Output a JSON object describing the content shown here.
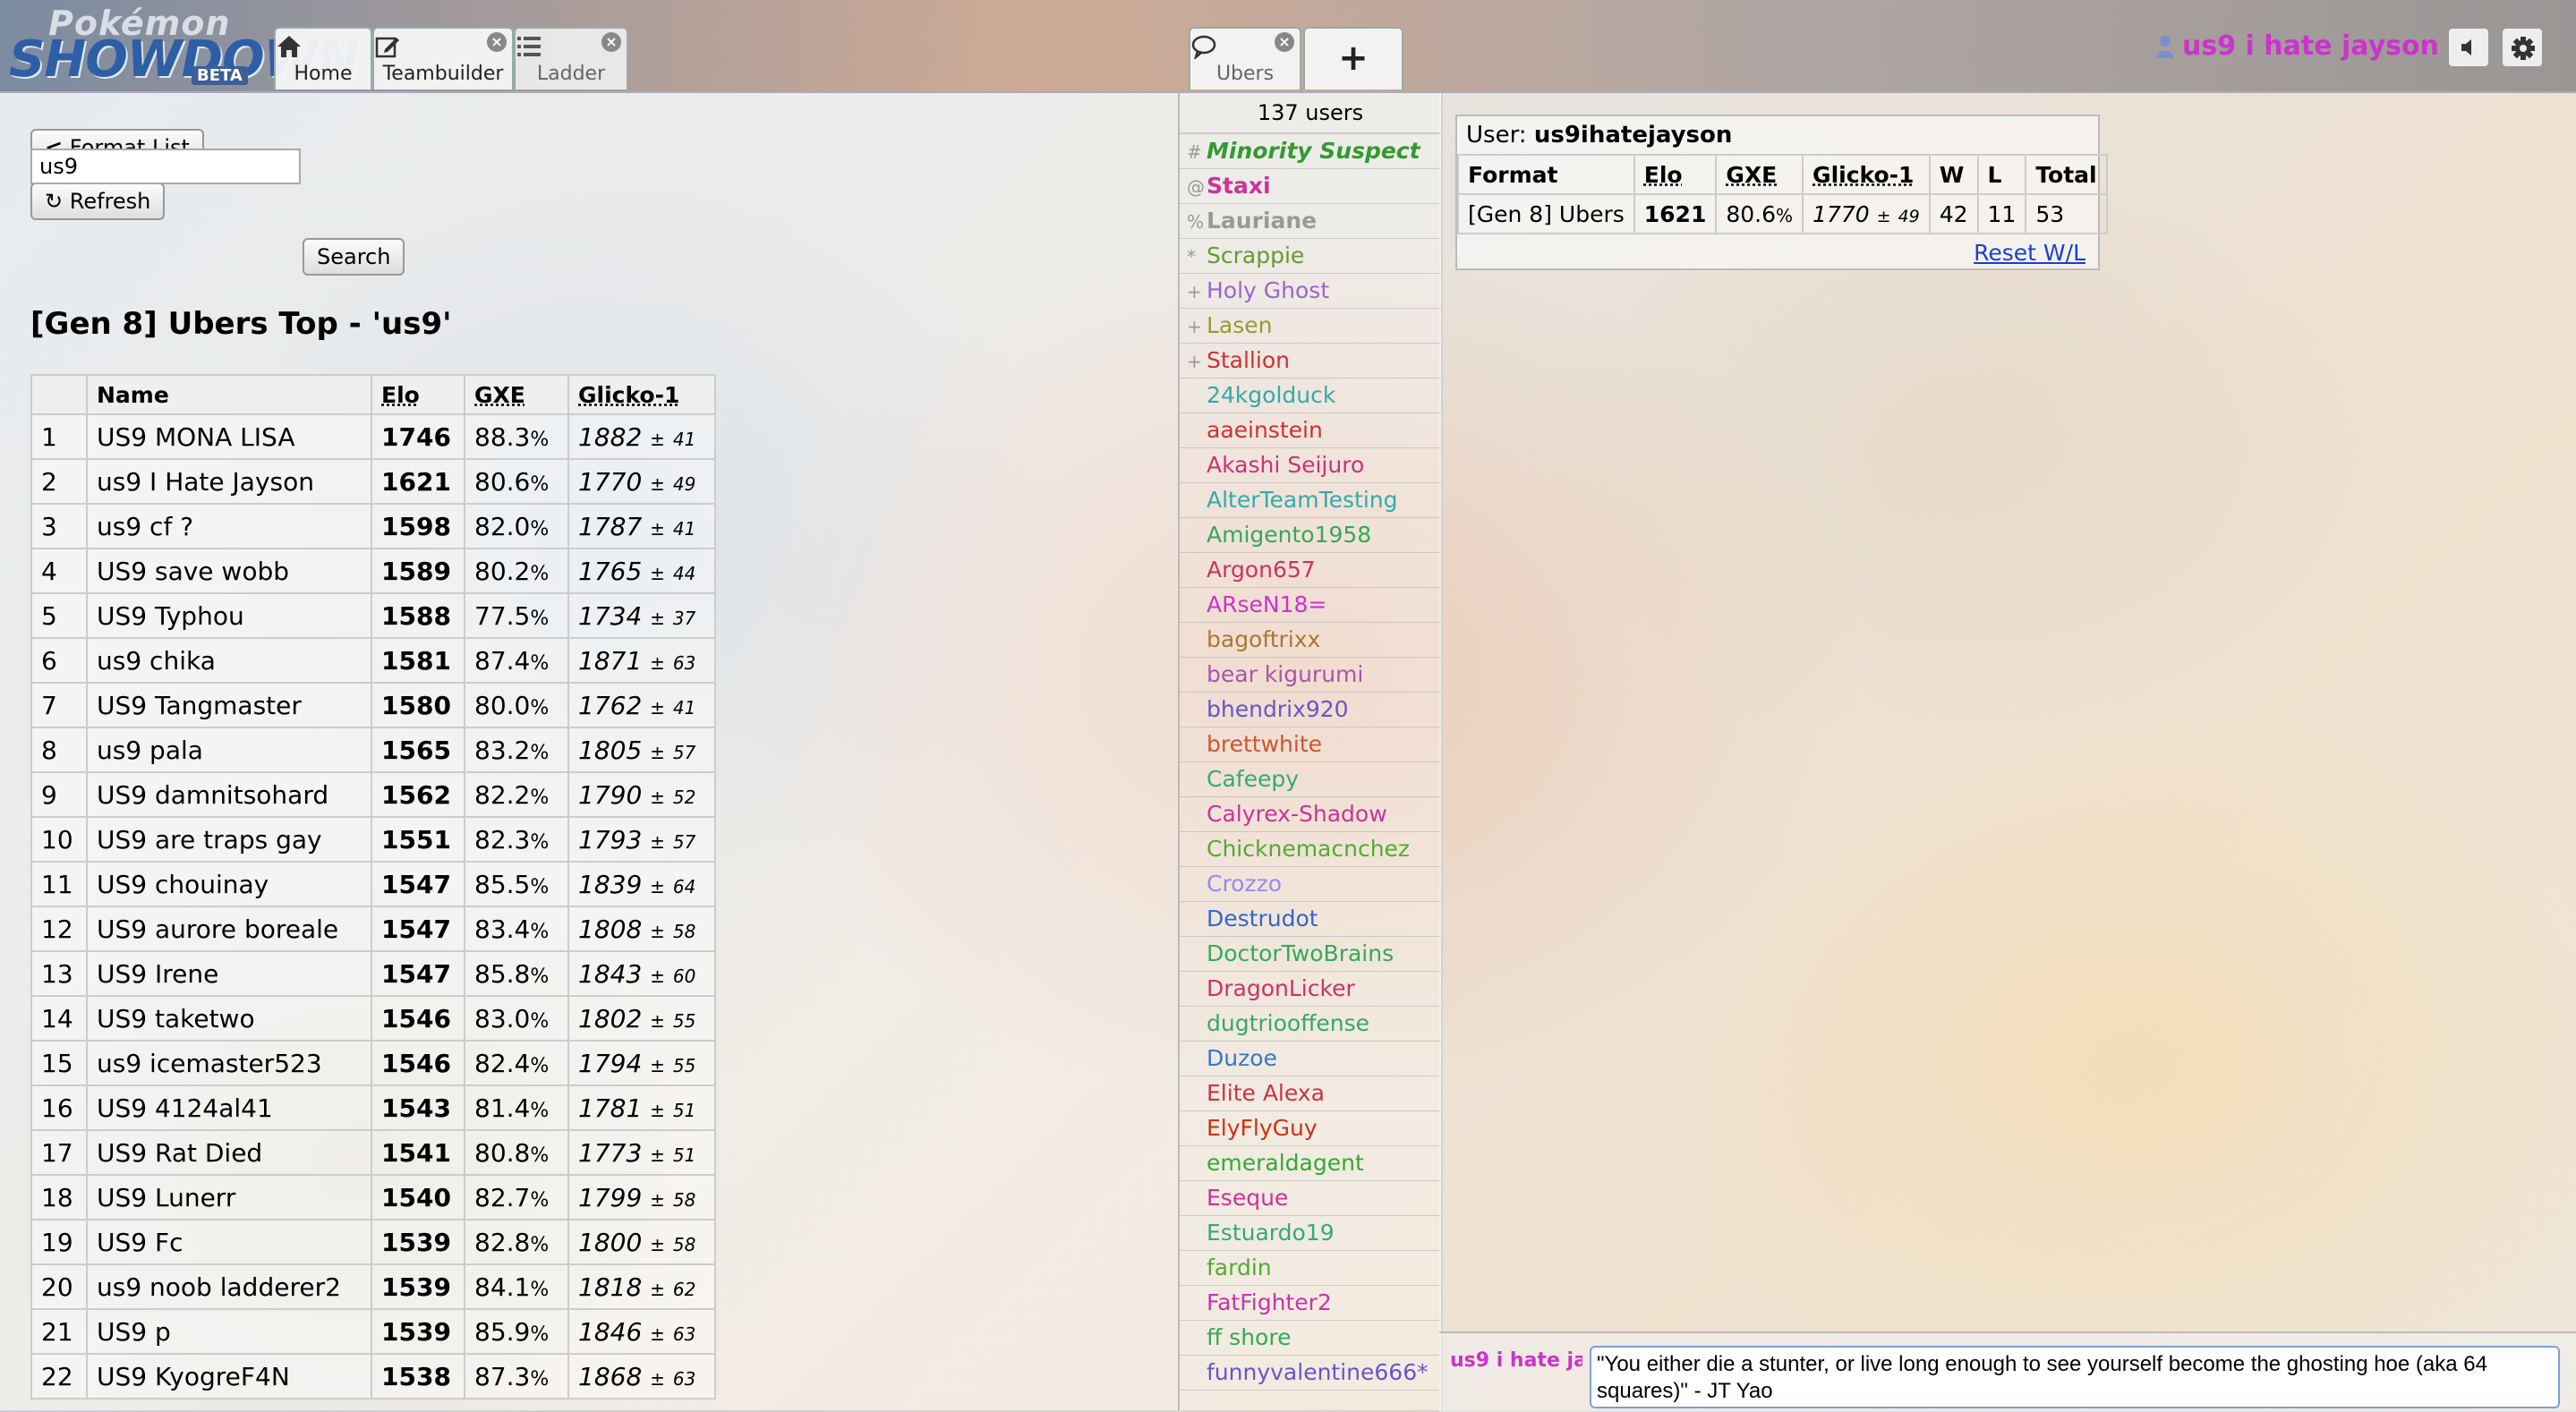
{
  "header": {
    "logo": {
      "pokemon": "Pokémon",
      "showdown": "SHOWDOWN",
      "beta": "BETA"
    },
    "tabs": [
      {
        "label": "Home",
        "icon": "home-icon"
      },
      {
        "label": "Teambuilder",
        "icon": "pencil-icon",
        "closable": true
      },
      {
        "label": "Ladder",
        "icon": "list-icon",
        "closable": true
      }
    ],
    "room_tabs": [
      {
        "label": "Ubers",
        "icon": "chat-bubble-icon",
        "closable": true
      },
      {
        "label": "+",
        "icon": "plus-icon"
      }
    ],
    "close_glyph": "×",
    "username": "us9 i hate jayson",
    "user_color": "#cc33cc"
  },
  "ladder": {
    "format_list_label": "Format List",
    "refresh_label": "Refresh",
    "search_value": "us9",
    "search_label": "Search",
    "title": "[Gen 8] Ubers Top - 'us9'",
    "columns": [
      "",
      "Name",
      "Elo",
      "GXE",
      "Glicko-1"
    ],
    "rows": [
      {
        "rank": "1",
        "name": "US9 MONA LISA",
        "elo": "1746",
        "gxe": "88.3",
        "glicko": "1882",
        "dev": "41"
      },
      {
        "rank": "2",
        "name": "us9 I Hate Jayson",
        "elo": "1621",
        "gxe": "80.6",
        "glicko": "1770",
        "dev": "49"
      },
      {
        "rank": "3",
        "name": "us9 cf ?",
        "elo": "1598",
        "gxe": "82.0",
        "glicko": "1787",
        "dev": "41"
      },
      {
        "rank": "4",
        "name": "US9 save wobb",
        "elo": "1589",
        "gxe": "80.2",
        "glicko": "1765",
        "dev": "44"
      },
      {
        "rank": "5",
        "name": "US9 Typhou",
        "elo": "1588",
        "gxe": "77.5",
        "glicko": "1734",
        "dev": "37"
      },
      {
        "rank": "6",
        "name": "us9 chika",
        "elo": "1581",
        "gxe": "87.4",
        "glicko": "1871",
        "dev": "63"
      },
      {
        "rank": "7",
        "name": "US9 Tangmaster",
        "elo": "1580",
        "gxe": "80.0",
        "glicko": "1762",
        "dev": "41"
      },
      {
        "rank": "8",
        "name": "us9 pala",
        "elo": "1565",
        "gxe": "83.2",
        "glicko": "1805",
        "dev": "57"
      },
      {
        "rank": "9",
        "name": "US9 damnitsohard",
        "elo": "1562",
        "gxe": "82.2",
        "glicko": "1790",
        "dev": "52"
      },
      {
        "rank": "10",
        "name": "US9 are traps gay",
        "elo": "1551",
        "gxe": "82.3",
        "glicko": "1793",
        "dev": "57"
      },
      {
        "rank": "11",
        "name": "US9 chouinay",
        "elo": "1547",
        "gxe": "85.5",
        "glicko": "1839",
        "dev": "64"
      },
      {
        "rank": "12",
        "name": "US9 aurore boreale",
        "elo": "1547",
        "gxe": "83.4",
        "glicko": "1808",
        "dev": "58"
      },
      {
        "rank": "13",
        "name": "US9 Irene",
        "elo": "1547",
        "gxe": "85.8",
        "glicko": "1843",
        "dev": "60"
      },
      {
        "rank": "14",
        "name": "US9 taketwo",
        "elo": "1546",
        "gxe": "83.0",
        "glicko": "1802",
        "dev": "55"
      },
      {
        "rank": "15",
        "name": "us9 icemaster523",
        "elo": "1546",
        "gxe": "82.4",
        "glicko": "1794",
        "dev": "55"
      },
      {
        "rank": "16",
        "name": "US9 4124al41",
        "elo": "1543",
        "gxe": "81.4",
        "glicko": "1781",
        "dev": "51"
      },
      {
        "rank": "17",
        "name": "US9 Rat Died",
        "elo": "1541",
        "gxe": "80.8",
        "glicko": "1773",
        "dev": "51"
      },
      {
        "rank": "18",
        "name": "US9 Lunerr",
        "elo": "1540",
        "gxe": "82.7",
        "glicko": "1799",
        "dev": "58"
      },
      {
        "rank": "19",
        "name": "US9 Fc",
        "elo": "1539",
        "gxe": "82.8",
        "glicko": "1800",
        "dev": "58"
      },
      {
        "rank": "20",
        "name": "us9 noob ladderer2",
        "elo": "1539",
        "gxe": "84.1",
        "glicko": "1818",
        "dev": "62"
      },
      {
        "rank": "21",
        "name": "US9 p",
        "elo": "1539",
        "gxe": "85.9",
        "glicko": "1846",
        "dev": "63"
      },
      {
        "rank": "22",
        "name": "US9 KyogreF4N",
        "elo": "1538",
        "gxe": "87.3",
        "glicko": "1868",
        "dev": "63"
      }
    ],
    "pm": "±",
    "pct": "%"
  },
  "userlist": {
    "count": "137 users",
    "users": [
      {
        "rank": "#",
        "name": "Minority Suspect",
        "color": "#339933",
        "style": "bi"
      },
      {
        "rank": "@",
        "name": "Staxi",
        "color": "#cc3399",
        "style": "b"
      },
      {
        "rank": "%",
        "name": "Lauriane",
        "color": "#999999",
        "style": "b"
      },
      {
        "rank": "*",
        "name": "Scrappie",
        "color": "#669933",
        "style": ""
      },
      {
        "rank": "+",
        "name": "Holy Ghost",
        "color": "#9966cc",
        "style": ""
      },
      {
        "rank": "+",
        "name": "Lasen",
        "color": "#999933",
        "style": ""
      },
      {
        "rank": "+",
        "name": "Stallion",
        "color": "#cc3333",
        "style": ""
      },
      {
        "rank": "",
        "name": "24kgolduck",
        "color": "#33aaaa",
        "style": ""
      },
      {
        "rank": "",
        "name": "aaeinstein",
        "color": "#cc3333",
        "style": ""
      },
      {
        "rank": "",
        "name": "Akashi Seijuro",
        "color": "#cc3377",
        "style": ""
      },
      {
        "rank": "",
        "name": "AlterTeamTesting",
        "color": "#33aaaa",
        "style": ""
      },
      {
        "rank": "",
        "name": "Amigento1958",
        "color": "#33aa55",
        "style": ""
      },
      {
        "rank": "",
        "name": "Argon657",
        "color": "#cc3366",
        "style": ""
      },
      {
        "rank": "",
        "name": "ARseN18=",
        "color": "#cc33cc",
        "style": ""
      },
      {
        "rank": "",
        "name": "bagoftrixx",
        "color": "#aa7733",
        "style": ""
      },
      {
        "rank": "",
        "name": "bear kigurumi",
        "color": "#aa55aa",
        "style": ""
      },
      {
        "rank": "",
        "name": "bhendrix920",
        "color": "#6655cc",
        "style": ""
      },
      {
        "rank": "",
        "name": "brettwhite",
        "color": "#cc5533",
        "style": ""
      },
      {
        "rank": "",
        "name": "Cafeepy",
        "color": "#33aa77",
        "style": ""
      },
      {
        "rank": "",
        "name": "Calyrex-Shadow",
        "color": "#cc3399",
        "style": ""
      },
      {
        "rank": "",
        "name": "Chicknemacnchez",
        "color": "#55aa33",
        "style": ""
      },
      {
        "rank": "",
        "name": "Crozzo",
        "color": "#9988ee",
        "style": ""
      },
      {
        "rank": "",
        "name": "Destrudot",
        "color": "#3366cc",
        "style": ""
      },
      {
        "rank": "",
        "name": "DoctorTwoBrains",
        "color": "#33aa55",
        "style": ""
      },
      {
        "rank": "",
        "name": "DragonLicker",
        "color": "#cc3366",
        "style": ""
      },
      {
        "rank": "",
        "name": "dugtriooffense",
        "color": "#33aa66",
        "style": ""
      },
      {
        "rank": "",
        "name": "Duzoe",
        "color": "#3377cc",
        "style": ""
      },
      {
        "rank": "",
        "name": "Elite Alexa",
        "color": "#cc3344",
        "style": ""
      },
      {
        "rank": "",
        "name": "ElyFlyGuy",
        "color": "#cc3311",
        "style": ""
      },
      {
        "rank": "",
        "name": "emeraldagent",
        "color": "#33aa33",
        "style": ""
      },
      {
        "rank": "",
        "name": "Eseque",
        "color": "#cc3399",
        "style": ""
      },
      {
        "rank": "",
        "name": "Estuardo19",
        "color": "#33aa77",
        "style": ""
      },
      {
        "rank": "",
        "name": "fardin",
        "color": "#55aa33",
        "style": ""
      },
      {
        "rank": "",
        "name": "FatFighter2",
        "color": "#cc33aa",
        "style": ""
      },
      {
        "rank": "",
        "name": "ff shore",
        "color": "#33aa55",
        "style": ""
      },
      {
        "rank": "",
        "name": "funnyvalentine666*",
        "color": "#6655cc",
        "style": ""
      }
    ]
  },
  "user_stats": {
    "user_label": "User:",
    "user_id": "us9ihatejayson",
    "columns": [
      "Format",
      "Elo",
      "GXE",
      "Glicko-1",
      "W",
      "L",
      "Total"
    ],
    "row": {
      "format": "[Gen 8] Ubers",
      "elo": "1621",
      "gxe": "80.6",
      "glicko": "1770",
      "dev": "49",
      "w": "42",
      "l": "11",
      "total": "53"
    },
    "reset_label": "Reset W/L"
  },
  "chat": {
    "user_short": "us9 i hate ja",
    "input_value": "\"You either die a stunter, or live long enough to see yourself become the ghosting hoe (aka 64 squares)\" - JT Yao"
  }
}
